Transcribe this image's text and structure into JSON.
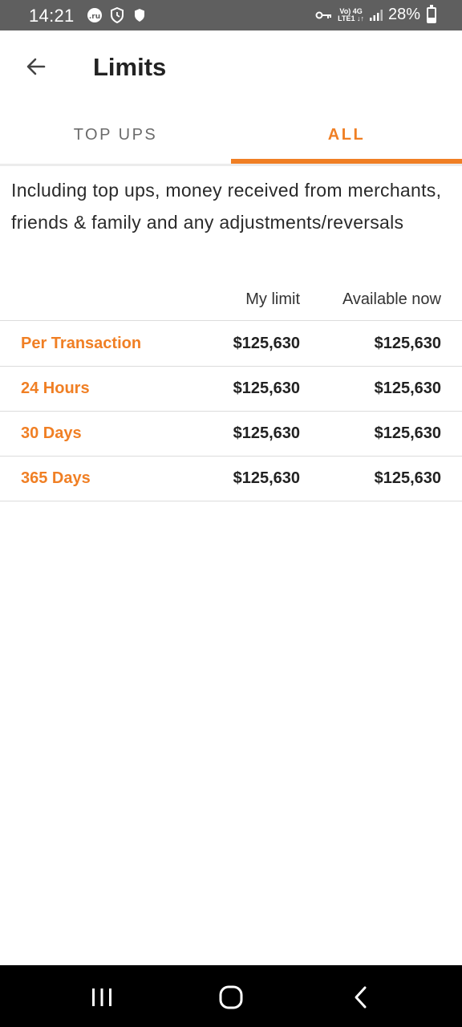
{
  "status_bar": {
    "time": "14:21",
    "left_icons": [
      "ru-app-icon",
      "shield-clock-icon",
      "shield-icon"
    ],
    "right_icons": [
      "vpn-key-icon",
      "volte-icon",
      "4g-icon",
      "signal-icon",
      "battery-icon"
    ],
    "network_line1": "Vo) 4G",
    "network_line2": "LTE1 ↓↑",
    "battery": "28%",
    "battery_level": 0.28
  },
  "app_bar": {
    "title": "Limits",
    "back_icon": "arrow-left-icon"
  },
  "tabs": [
    {
      "label": "TOP UPS",
      "selected": false
    },
    {
      "label": "ALL",
      "selected": true
    }
  ],
  "description": "Including top ups, money received from merchants, friends & family and any adjustments/reversals",
  "table": {
    "columns": [
      "My limit",
      "Available now"
    ],
    "rows": [
      {
        "label": "Per Transaction",
        "my_limit": "$125,630",
        "available": "$125,630"
      },
      {
        "label": "24 Hours",
        "my_limit": "$125,630",
        "available": "$125,630"
      },
      {
        "label": "30 Days",
        "my_limit": "$125,630",
        "available": "$125,630"
      },
      {
        "label": "365 Days",
        "my_limit": "$125,630",
        "available": "$125,630"
      }
    ]
  },
  "colors": {
    "accent": "#f07f24",
    "status_bar": "#5f5f5f",
    "nav_bar": "#000000"
  },
  "nav_bar": {
    "icons": [
      "recent-apps-icon",
      "home-icon",
      "back-icon"
    ]
  }
}
